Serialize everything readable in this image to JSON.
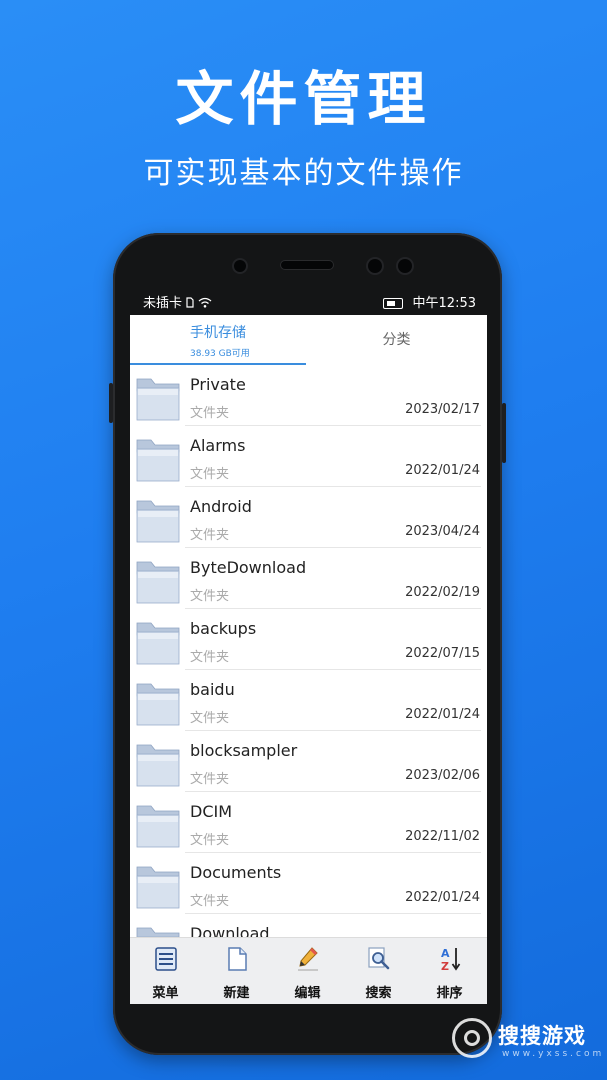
{
  "hero": {
    "title": "文件管理",
    "subtitle": "可实现基本的文件操作"
  },
  "statusbar": {
    "left": "未插卡",
    "time": "中午12:53"
  },
  "tabs": [
    {
      "label": "手机存储",
      "sub": "38.93 GB可用",
      "active": true
    },
    {
      "label": "分类",
      "active": false
    }
  ],
  "files": [
    {
      "name": "Private",
      "type": "文件夹",
      "date": "2023/02/17"
    },
    {
      "name": "Alarms",
      "type": "文件夹",
      "date": "2022/01/24"
    },
    {
      "name": "Android",
      "type": "文件夹",
      "date": "2023/04/24"
    },
    {
      "name": "ByteDownload",
      "type": "文件夹",
      "date": "2022/02/19"
    },
    {
      "name": "backups",
      "type": "文件夹",
      "date": "2022/07/15"
    },
    {
      "name": "baidu",
      "type": "文件夹",
      "date": "2022/01/24"
    },
    {
      "name": "blocksampler",
      "type": "文件夹",
      "date": "2023/02/06"
    },
    {
      "name": "DCIM",
      "type": "文件夹",
      "date": "2022/11/02"
    },
    {
      "name": "Documents",
      "type": "文件夹",
      "date": "2022/01/24"
    },
    {
      "name": "Download",
      "type": "",
      "date": ""
    }
  ],
  "bottombar": [
    {
      "label": "菜单",
      "icon": "menu-icon"
    },
    {
      "label": "新建",
      "icon": "new-file-icon"
    },
    {
      "label": "编辑",
      "icon": "pencil-icon"
    },
    {
      "label": "搜索",
      "icon": "search-icon"
    },
    {
      "label": "排序",
      "icon": "sort-az-icon"
    }
  ],
  "watermark": {
    "text": "搜搜游戏",
    "url": "www.yxss.com"
  },
  "colors": {
    "background": "#1f7ef0",
    "accent": "#3a8dde",
    "phone": "#141516"
  }
}
